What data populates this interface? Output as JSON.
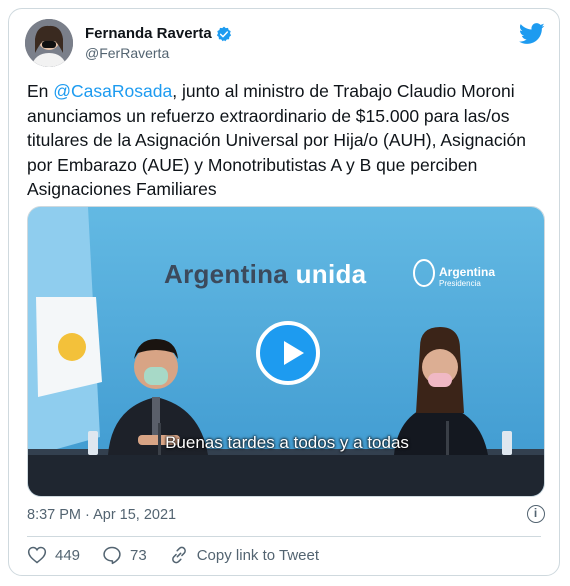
{
  "user": {
    "name": "Fernanda Raverta",
    "handle": "@FerRaverta"
  },
  "tweet": {
    "mention": "@CasaRosada",
    "text_before": "En ",
    "text_after": ", junto al ministro de Trabajo Claudio Moroni anunciamos un refuerzo extraordinario de $15.000 para las/os titulares de la Asignación Universal por Hija/o (AUH), Asignación por Embarazo (AUE) y Monotributistas A y B que perciben Asignaciones Familiares"
  },
  "media": {
    "banner_left": "Argentina",
    "banner_right": "unida",
    "logo_text": "Argentina",
    "logo_sub": "Presidencia",
    "subtitle": "Buenas tardes a todos y a todas"
  },
  "meta": {
    "timestamp": "8:37 PM · Apr 15, 2021"
  },
  "actions": {
    "likes": "449",
    "replies": "73",
    "copy_link": "Copy link to Tweet"
  },
  "colors": {
    "accent": "#1d9bf0",
    "text": "#0f1419",
    "muted": "#536471",
    "verified": "#1d9bf0",
    "like": "#536471"
  },
  "icons": [
    "verified-badge-icon",
    "twitter-bird-icon",
    "play-icon",
    "info-icon",
    "heart-icon",
    "reply-icon",
    "link-icon"
  ]
}
